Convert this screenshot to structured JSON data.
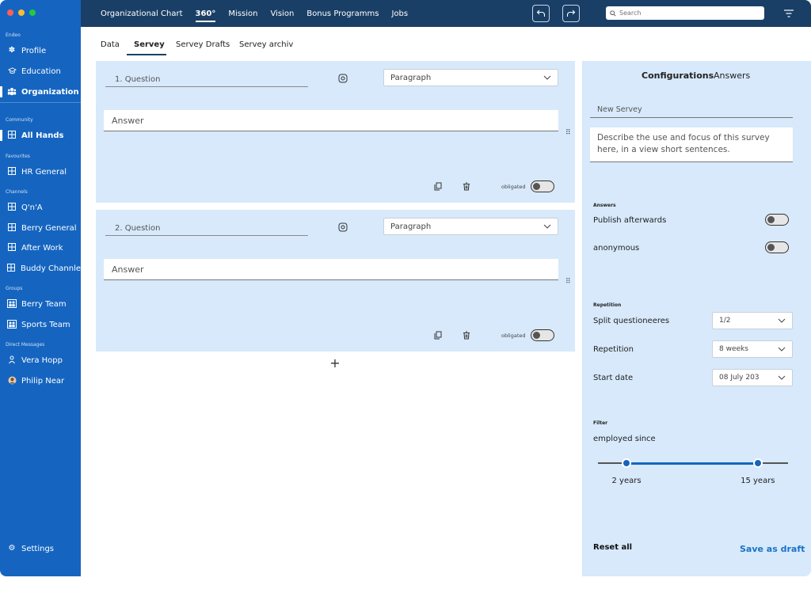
{
  "colors": {
    "sidebar_bg": "#1565c0",
    "topbar_bg": "#1a3f66",
    "card_bg": "#d7e9fb",
    "accent": "#1a73c8",
    "traffic_red": "#ff5f57",
    "traffic_yellow": "#febc2e",
    "traffic_green": "#28c840"
  },
  "sidebar": {
    "org_label": "Endeo",
    "items_main": [
      {
        "label": "Profile",
        "icon": "palette-icon"
      },
      {
        "label": "Education",
        "icon": "graduation-cap-icon"
      },
      {
        "label": "Organization",
        "icon": "people-icon"
      }
    ],
    "community_label": "Community",
    "community_items": [
      {
        "label": "All Hands",
        "icon": "board-icon"
      }
    ],
    "favourites_label": "Favourites",
    "favourites_items": [
      {
        "label": "HR General",
        "icon": "board-icon"
      }
    ],
    "channels_label": "Channels",
    "channels_items": [
      {
        "label": "Q'n'A",
        "icon": "board-icon"
      },
      {
        "label": "Berry General",
        "icon": "board-icon"
      },
      {
        "label": "After Work",
        "icon": "board-icon"
      },
      {
        "label": "Buddy Channle",
        "icon": "board-icon"
      }
    ],
    "groups_label": "Groups",
    "groups_items": [
      {
        "label": "Berry Team",
        "icon": "group-icon"
      },
      {
        "label": "Sports Team",
        "icon": "group-icon"
      }
    ],
    "dm_label": "Direct Messages",
    "dm_items": [
      {
        "label": "Vera Hopp",
        "icon": "person-icon"
      },
      {
        "label": "Philip Near",
        "icon": "avatar-icon"
      }
    ],
    "settings_label": "Settings"
  },
  "topbar": {
    "nav": [
      "Organizational Chart",
      "360°",
      "Mission",
      "Vision",
      "Bonus Programms",
      "Jobs"
    ],
    "active_index": 1,
    "search_placeholder": "Search"
  },
  "subtabs": {
    "items": [
      "Data",
      "Servey",
      "Servey Drafts",
      "Servey archiv"
    ],
    "active_index": 1
  },
  "questions": [
    {
      "question_label": "1. Question",
      "type": "Paragraph",
      "answer_placeholder": "Answer",
      "obligated_label": "obligated",
      "obligated": false
    },
    {
      "question_label": "2. Question",
      "type": "Paragraph",
      "answer_placeholder": "Answer",
      "obligated_label": "obligated",
      "obligated": false
    }
  ],
  "add_symbol": "+",
  "config": {
    "tab_configurations": "Configurations",
    "tab_answers": "Answers",
    "title_placeholder": "New Servey",
    "description_placeholder": "Describe the use and focus of this survey here, in a view short sentences.",
    "answers_section": "Answers",
    "publish_afterwards": "Publish afterwards",
    "publish_afterwards_on": false,
    "anonymous": "anonymous",
    "anonymous_on": false,
    "repetition_section": "Repetition",
    "split_label": "Split questioneeres",
    "split_value": "1/2",
    "repetition_label": "Repetition",
    "repetition_value": "8 weeks",
    "start_label": "Start date",
    "start_value": "08 July 203",
    "filter_section": "Filter",
    "employed_since": "employed since",
    "slider_min_label": "2 years",
    "slider_max_label": "15 years",
    "slider_low_fraction": 0.15,
    "slider_high_fraction": 0.84,
    "reset_label": "Reset all",
    "save_label": "Save as draft"
  }
}
